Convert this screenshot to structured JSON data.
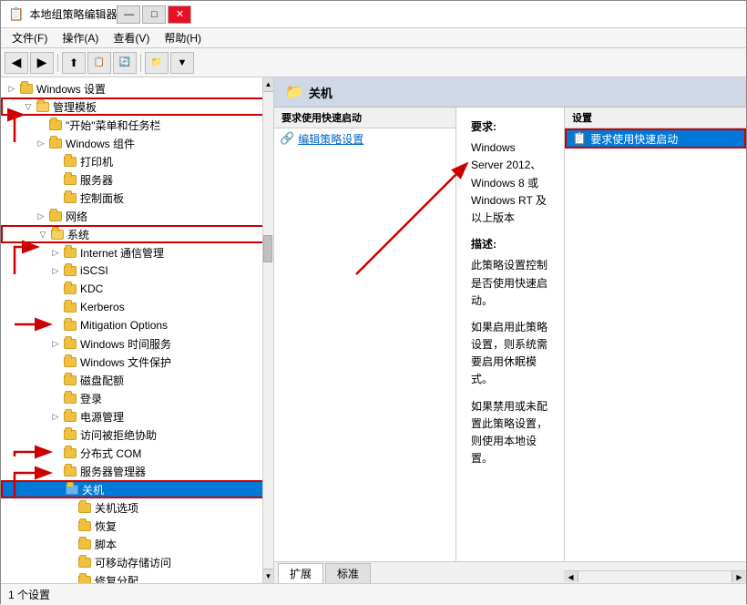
{
  "window": {
    "title": "本地组策略编辑器",
    "icon": "📋"
  },
  "titlebar": {
    "minimize": "—",
    "maximize": "□",
    "close": "✕"
  },
  "menu": {
    "items": [
      "文件(F)",
      "操作(A)",
      "查看(V)",
      "帮助(H)"
    ]
  },
  "toolbar": {
    "buttons": [
      "◀",
      "▶",
      "⬆",
      "📁",
      "📁",
      "🗑",
      "🖊",
      "▦",
      "🔽"
    ]
  },
  "tree": {
    "items": [
      {
        "id": "windows-settings",
        "label": "Windows 设置",
        "indent": 0,
        "expanded": true,
        "hasArrow": true,
        "selected": false
      },
      {
        "id": "admin-templates",
        "label": "管理模板",
        "indent": 1,
        "expanded": true,
        "hasArrow": true,
        "selected": false
      },
      {
        "id": "start-menu",
        "label": "\"开始\"菜单和任务栏",
        "indent": 2,
        "expanded": false,
        "hasArrow": false,
        "selected": false
      },
      {
        "id": "windows-components",
        "label": "Windows 组件",
        "indent": 2,
        "expanded": false,
        "hasArrow": true,
        "selected": false
      },
      {
        "id": "printer",
        "label": "打印机",
        "indent": 2,
        "expanded": false,
        "hasArrow": false,
        "selected": false
      },
      {
        "id": "server",
        "label": "服务器",
        "indent": 2,
        "expanded": false,
        "hasArrow": false,
        "selected": false
      },
      {
        "id": "control-panel",
        "label": "控制面板",
        "indent": 2,
        "expanded": false,
        "hasArrow": false,
        "selected": false
      },
      {
        "id": "network",
        "label": "网络",
        "indent": 2,
        "expanded": false,
        "hasArrow": true,
        "selected": false
      },
      {
        "id": "system",
        "label": "系统",
        "indent": 2,
        "expanded": true,
        "hasArrow": true,
        "selected": false
      },
      {
        "id": "internet-comm",
        "label": "Internet 通信管理",
        "indent": 3,
        "expanded": false,
        "hasArrow": true,
        "selected": false
      },
      {
        "id": "iscsi",
        "label": "iSCSI",
        "indent": 3,
        "expanded": false,
        "hasArrow": true,
        "selected": false
      },
      {
        "id": "kdc",
        "label": "KDC",
        "indent": 3,
        "expanded": false,
        "hasArrow": false,
        "selected": false
      },
      {
        "id": "kerberos",
        "label": "Kerberos",
        "indent": 3,
        "expanded": false,
        "hasArrow": false,
        "selected": false
      },
      {
        "id": "mitigation",
        "label": "Mitigation Options",
        "indent": 3,
        "expanded": false,
        "hasArrow": false,
        "selected": false
      },
      {
        "id": "windows-time",
        "label": "Windows 时间服务",
        "indent": 3,
        "expanded": false,
        "hasArrow": true,
        "selected": false
      },
      {
        "id": "windows-file-protect",
        "label": "Windows 文件保护",
        "indent": 3,
        "expanded": false,
        "hasArrow": false,
        "selected": false
      },
      {
        "id": "disk-quota",
        "label": "磁盘配额",
        "indent": 3,
        "expanded": false,
        "hasArrow": false,
        "selected": false
      },
      {
        "id": "login",
        "label": "登录",
        "indent": 3,
        "expanded": false,
        "hasArrow": false,
        "selected": false
      },
      {
        "id": "power-mgmt",
        "label": "电源管理",
        "indent": 3,
        "expanded": false,
        "hasArrow": true,
        "selected": false
      },
      {
        "id": "access-denied",
        "label": "访问被拒绝协助",
        "indent": 3,
        "expanded": false,
        "hasArrow": false,
        "selected": false
      },
      {
        "id": "distributed-com",
        "label": "分布式 COM",
        "indent": 3,
        "expanded": false,
        "hasArrow": false,
        "selected": false
      },
      {
        "id": "server-mgr",
        "label": "服务器管理器",
        "indent": 3,
        "expanded": false,
        "hasArrow": false,
        "selected": false
      },
      {
        "id": "shutdown",
        "label": "关机",
        "indent": 3,
        "expanded": false,
        "hasArrow": false,
        "selected": true
      },
      {
        "id": "shutdown-options",
        "label": "关机选项",
        "indent": 4,
        "expanded": false,
        "hasArrow": false,
        "selected": false
      },
      {
        "id": "recovery",
        "label": "恢复",
        "indent": 4,
        "expanded": false,
        "hasArrow": false,
        "selected": false
      },
      {
        "id": "script",
        "label": "脚本",
        "indent": 4,
        "expanded": false,
        "hasArrow": false,
        "selected": false
      },
      {
        "id": "removable",
        "label": "可移动存储访问",
        "indent": 4,
        "expanded": false,
        "hasArrow": false,
        "selected": false
      },
      {
        "id": "more",
        "label": "修复分配",
        "indent": 4,
        "expanded": false,
        "hasArrow": false,
        "selected": false
      }
    ]
  },
  "right_panel": {
    "header": {
      "icon": "📁",
      "title": "关机"
    },
    "policy_section_label": "要求使用快速启动",
    "edit_link": "编辑策略设置",
    "requirements_label": "要求:",
    "requirements_text": "Windows Server 2012、Windows 8 或 Windows RT 及以上版本",
    "description_label": "描述:",
    "description_text": "此策略设置控制是否使用快速启动。",
    "description_extra1": "如果启用此策略设置，则系统需要启用休眠模式。",
    "description_extra2": "如果禁用或未配置此策略设置，则使用本地设置。"
  },
  "settings_panel": {
    "header": "设置",
    "items": [
      {
        "label": "要求使用快速启动",
        "selected": true
      }
    ]
  },
  "bottom_tabs": {
    "tabs": [
      "扩展",
      "标准"
    ]
  },
  "status_bar": {
    "text": "1 个设置"
  },
  "colors": {
    "selected_bg": "#0078d7",
    "accent_red": "#cc0000",
    "folder_yellow": "#f0c040"
  }
}
